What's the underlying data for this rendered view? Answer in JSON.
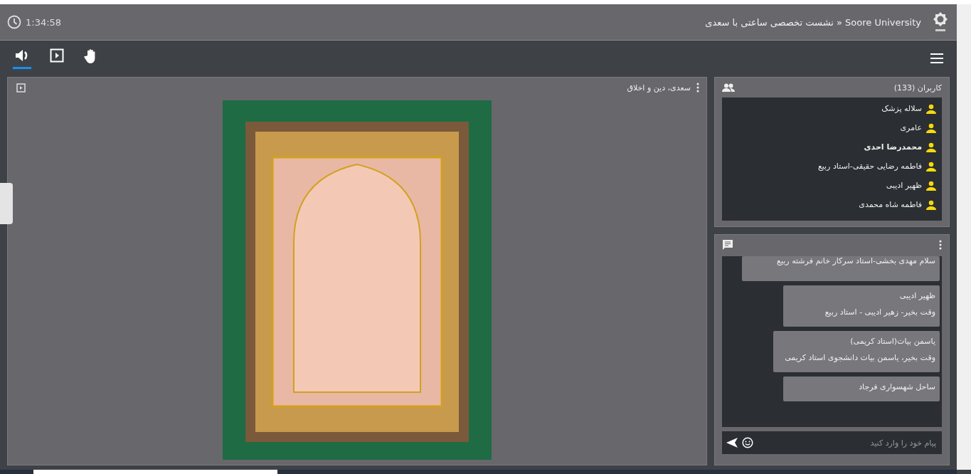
{
  "header": {
    "timer": "1:34:58",
    "title": "Soore University « نشست تخصصی ساعتی با سعدی"
  },
  "toolbar": [
    {
      "kind": "audio",
      "selected": true
    },
    {
      "kind": "media",
      "selected": false
    },
    {
      "kind": "hand",
      "selected": false
    }
  ],
  "presentation": {
    "title": "سعدی، دین و اخلاق"
  },
  "users": {
    "title": "کاربران (133)",
    "items": [
      {
        "name": "سلاله پزشک",
        "is_me": false
      },
      {
        "name": "عامری",
        "is_me": false
      },
      {
        "name": "محمدرضا احدی",
        "is_me": true
      },
      {
        "name": "فاطمه رضایی حقیقی-استاد ربیع",
        "is_me": false
      },
      {
        "name": "ظهیر ادیبی",
        "is_me": false
      },
      {
        "name": "فاطمه شاه محمدی",
        "is_me": false
      }
    ]
  },
  "chat": {
    "messages": [
      {
        "text": "سلام مهدی بخشی-استاد سرکار خانم فرشته ربیع"
      },
      {
        "sender": "ظهیر ادیبی",
        "text": "وقت بخیر- زهیر ادیبی - استاد ربیع"
      },
      {
        "sender": "یاسمن بیات(استاد کریمی)",
        "text": "وقت بخیر، یاسمن بیات دانشجوی استاد کریمی"
      },
      {
        "sender": "ساحل شهسواری فرجاد"
      }
    ],
    "input": {
      "placeholder": "پیام خود را وارد کنید"
    }
  }
}
